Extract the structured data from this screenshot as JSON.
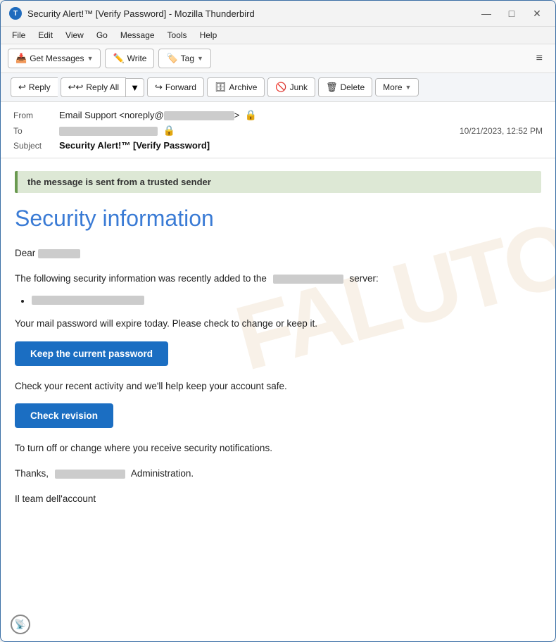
{
  "window": {
    "title": "Security Alert!™ [Verify Password] - Mozilla Thunderbird",
    "icon_label": "T"
  },
  "titlebar_controls": {
    "minimize": "—",
    "maximize": "□",
    "close": "✕"
  },
  "menu": {
    "items": [
      "File",
      "Edit",
      "View",
      "Go",
      "Message",
      "Tools",
      "Help"
    ]
  },
  "toolbar": {
    "get_messages": "Get Messages",
    "write": "Write",
    "tag": "Tag",
    "hamburger": "≡"
  },
  "actions": {
    "reply": "Reply",
    "reply_all": "Reply All",
    "forward": "Forward",
    "archive": "Archive",
    "junk": "Junk",
    "delete": "Delete",
    "more": "More"
  },
  "email_header": {
    "from_label": "From",
    "from_name": "Email Support <noreply@",
    "from_domain": ">",
    "to_label": "To",
    "date": "10/21/2023, 12:52 PM",
    "subject_label": "Subject",
    "subject": "Security Alert!™ [Verify Password]"
  },
  "email_body": {
    "trusted_banner": "the message is sent from a trusted sender",
    "title": "Security information",
    "greeting": "Dear",
    "paragraph1_pre": "The following security information was recently added to the",
    "paragraph1_post": "server:",
    "paragraph2": "Your mail password will expire today.  Please check to change or keep it.",
    "cta1": "Keep the current password",
    "paragraph3": "Check your recent activity and we'll help keep your account safe.",
    "cta2": "Check revision",
    "paragraph4": "To turn off or change where you receive security notifications.",
    "thanks": "Thanks,",
    "admin": "Administration.",
    "team": "Il team dell'account",
    "watermark": "FALUTO"
  }
}
